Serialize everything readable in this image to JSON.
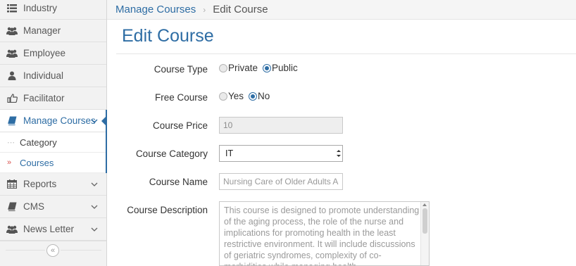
{
  "sidebar": {
    "items": [
      {
        "label": "Industry",
        "icon": "list-icon"
      },
      {
        "label": "Manager",
        "icon": "users-icon"
      },
      {
        "label": "Employee",
        "icon": "users-icon"
      },
      {
        "label": "Individual",
        "icon": "user-icon"
      },
      {
        "label": "Facilitator",
        "icon": "thumbs-up-icon"
      },
      {
        "label": "Manage Courses",
        "icon": "book-icon"
      },
      {
        "label": "Reports",
        "icon": "calendar-icon"
      },
      {
        "label": "CMS",
        "icon": "book-icon"
      },
      {
        "label": "News Letter",
        "icon": "users-icon"
      }
    ],
    "sub_items": [
      {
        "label": "Category",
        "marker": "⋯"
      },
      {
        "label": "Courses",
        "marker": "»"
      }
    ],
    "collapse_glyph": "«",
    "accent_color": "#2e6da4"
  },
  "breadcrumb": {
    "parent": "Manage Courses",
    "separator": "›",
    "current": "Edit Course"
  },
  "page_title": "Edit Course",
  "form": {
    "course_type": {
      "label": "Course Type",
      "options": [
        "Private",
        "Public"
      ],
      "selected": "Public"
    },
    "free_course": {
      "label": "Free Course",
      "options": [
        "Yes",
        "No"
      ],
      "selected": "No"
    },
    "course_price": {
      "label": "Course Price",
      "value": "10"
    },
    "course_category": {
      "label": "Course Category",
      "value": "IT"
    },
    "course_name": {
      "label": "Course Name",
      "value": "Nursing Care of Older Adults Acr"
    },
    "course_description": {
      "label": "Course Description",
      "value": "This course is designed to promote understanding of the aging process, the role of the nurse and implications for promoting health in the least restrictive environment. It will include discussions of geriatric syndromes, complexity of co-morbidities while managing health"
    }
  }
}
